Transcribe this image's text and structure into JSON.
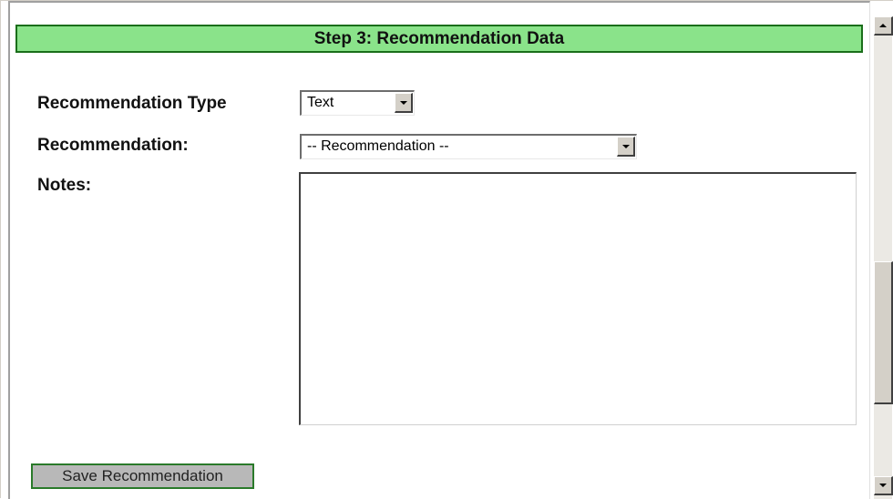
{
  "step_header": {
    "title": "Step 3: Recommendation Data",
    "background_color": "#8ae38a",
    "border_color": "#1a6e1a"
  },
  "form": {
    "recommendation_type": {
      "label": "Recommendation Type",
      "selected": "Text"
    },
    "recommendation": {
      "label": "Recommendation:",
      "selected": "-- Recommendation --"
    },
    "notes": {
      "label": "Notes:",
      "value": ""
    }
  },
  "actions": {
    "save_label": "Save Recommendation"
  },
  "scrollbar": {
    "up_icon": "arrow-up-icon",
    "down_icon": "arrow-down-icon",
    "position": 0.75
  }
}
